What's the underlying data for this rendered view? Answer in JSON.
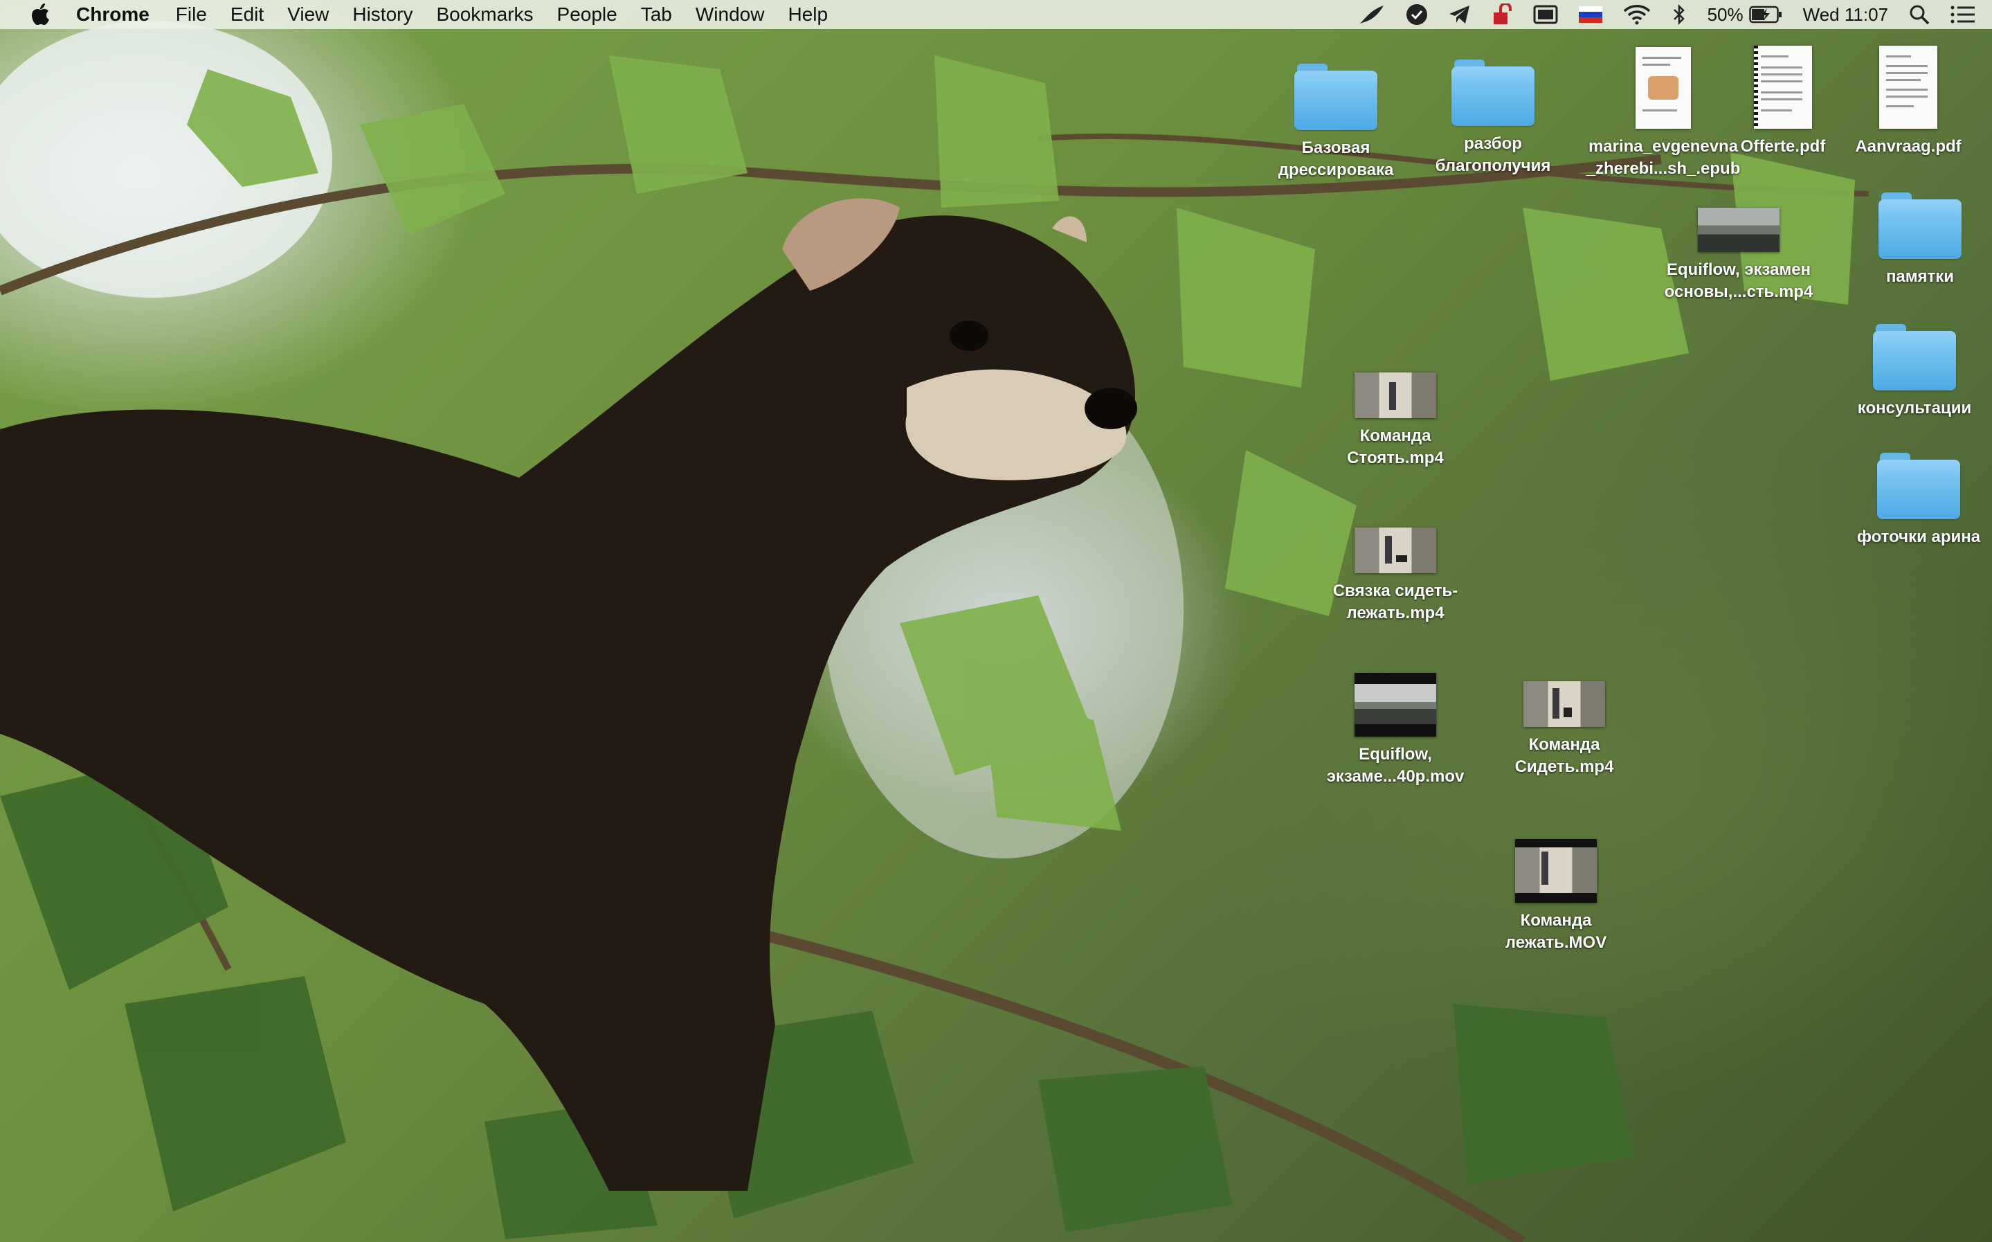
{
  "menubar": {
    "app_name": "Chrome",
    "menus": [
      "File",
      "Edit",
      "View",
      "History",
      "Bookmarks",
      "People",
      "Tab",
      "Window",
      "Help"
    ],
    "status_icons": [
      "feather-icon",
      "checkmark-circle-icon",
      "telegram-icon",
      "lock-icon",
      "display-icon",
      "russian-flag-icon",
      "wifi-icon",
      "bluetooth-icon"
    ],
    "battery_percent": "50%",
    "clock": "Wed 11:07"
  },
  "desktop": {
    "icons": [
      {
        "label": "Базовая\nдрессировака",
        "kind": "folder"
      },
      {
        "label": "разбор\nблагополучия",
        "kind": "folder"
      },
      {
        "label": "marina_evgenevna\n_zherebi...sh_.epub",
        "kind": "epub"
      },
      {
        "label": "Offerte.pdf",
        "kind": "pdf"
      },
      {
        "label": "Aanvraag.pdf",
        "kind": "pdf"
      },
      {
        "label": "Equiflow,  экзамен\nосновы,...сть.mp4",
        "kind": "video"
      },
      {
        "label": "памятки",
        "kind": "folder"
      },
      {
        "label": "консультации",
        "kind": "folder"
      },
      {
        "label": "фоточки арина",
        "kind": "folder"
      },
      {
        "label": "Команда\nСтоять.mp4",
        "kind": "video"
      },
      {
        "label": "Связка сидеть-\nлежать.mp4",
        "kind": "video"
      },
      {
        "label": "Equiflow,\nэкзаме...40p.mov",
        "kind": "video"
      },
      {
        "label": "Команда\nСидеть.mp4",
        "kind": "video"
      },
      {
        "label": "Команда\nлежать.MOV",
        "kind": "video"
      }
    ]
  }
}
